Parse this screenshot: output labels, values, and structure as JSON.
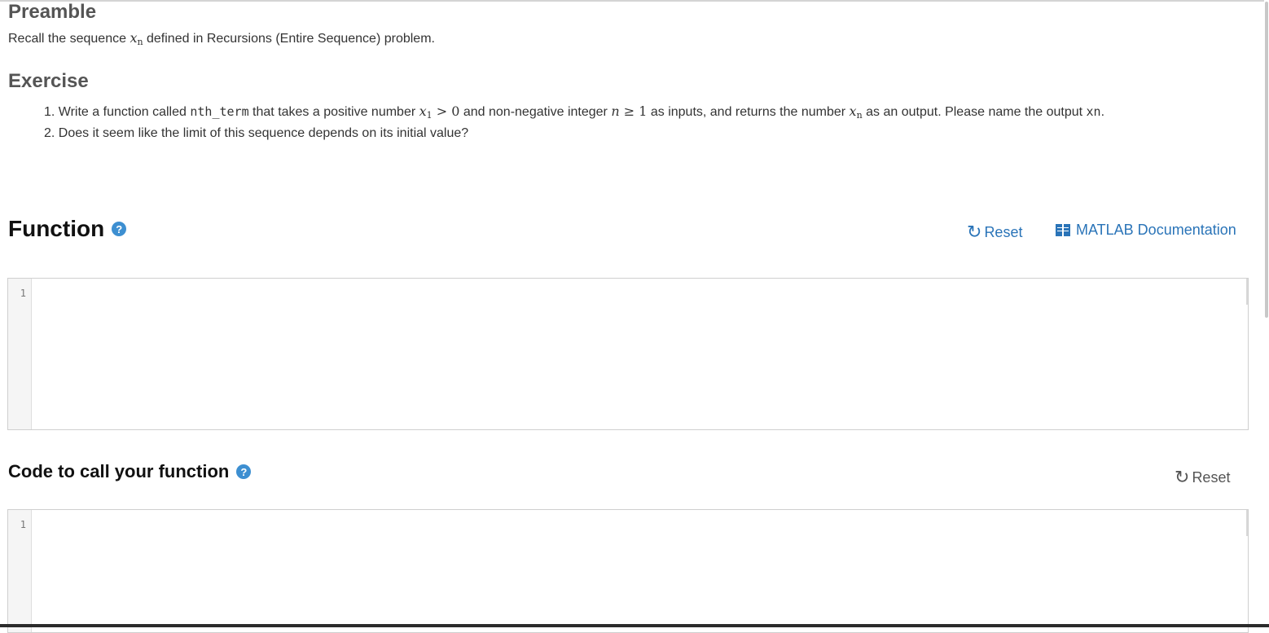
{
  "preamble": {
    "title": "Preamble",
    "text_before": "Recall the sequence ",
    "var_x": "x",
    "var_n": "n",
    "text_after": " defined in Recursions (Entire Sequence) problem."
  },
  "exercise": {
    "title": "Exercise",
    "item1": {
      "t1": "1. Write a function called ",
      "code": "nth_term",
      "t2": " that takes a positive number ",
      "m1": "x",
      "m1sub": "1",
      "m1rest": " > 0",
      "t3": " and non-negative integer ",
      "m2": "n",
      "m2rest": " ≥ 1",
      "t4": " as inputs, and returns the number ",
      "m3": "x",
      "m3sub": "n",
      "t5": " as an output.  Please name the output ",
      "out": "xn",
      "t6": "."
    },
    "item2": "2. Does it seem like the limit of this sequence depends on its initial value?"
  },
  "function_section": {
    "title": "Function",
    "help_icon": "?",
    "reset_label": "Reset",
    "doc_label": "MATLAB Documentation",
    "line_number": "1"
  },
  "code_section": {
    "title": "Code to call your function",
    "help_icon": "?",
    "reset_label": "Reset",
    "line_number": "1"
  },
  "icons": {
    "help": "question-circle-icon",
    "reset": "refresh-icon",
    "docs": "book-icon"
  },
  "colors": {
    "link_blue": "#2a74b8",
    "help_blue": "#3d8fd1",
    "heading_gray": "#555555"
  }
}
